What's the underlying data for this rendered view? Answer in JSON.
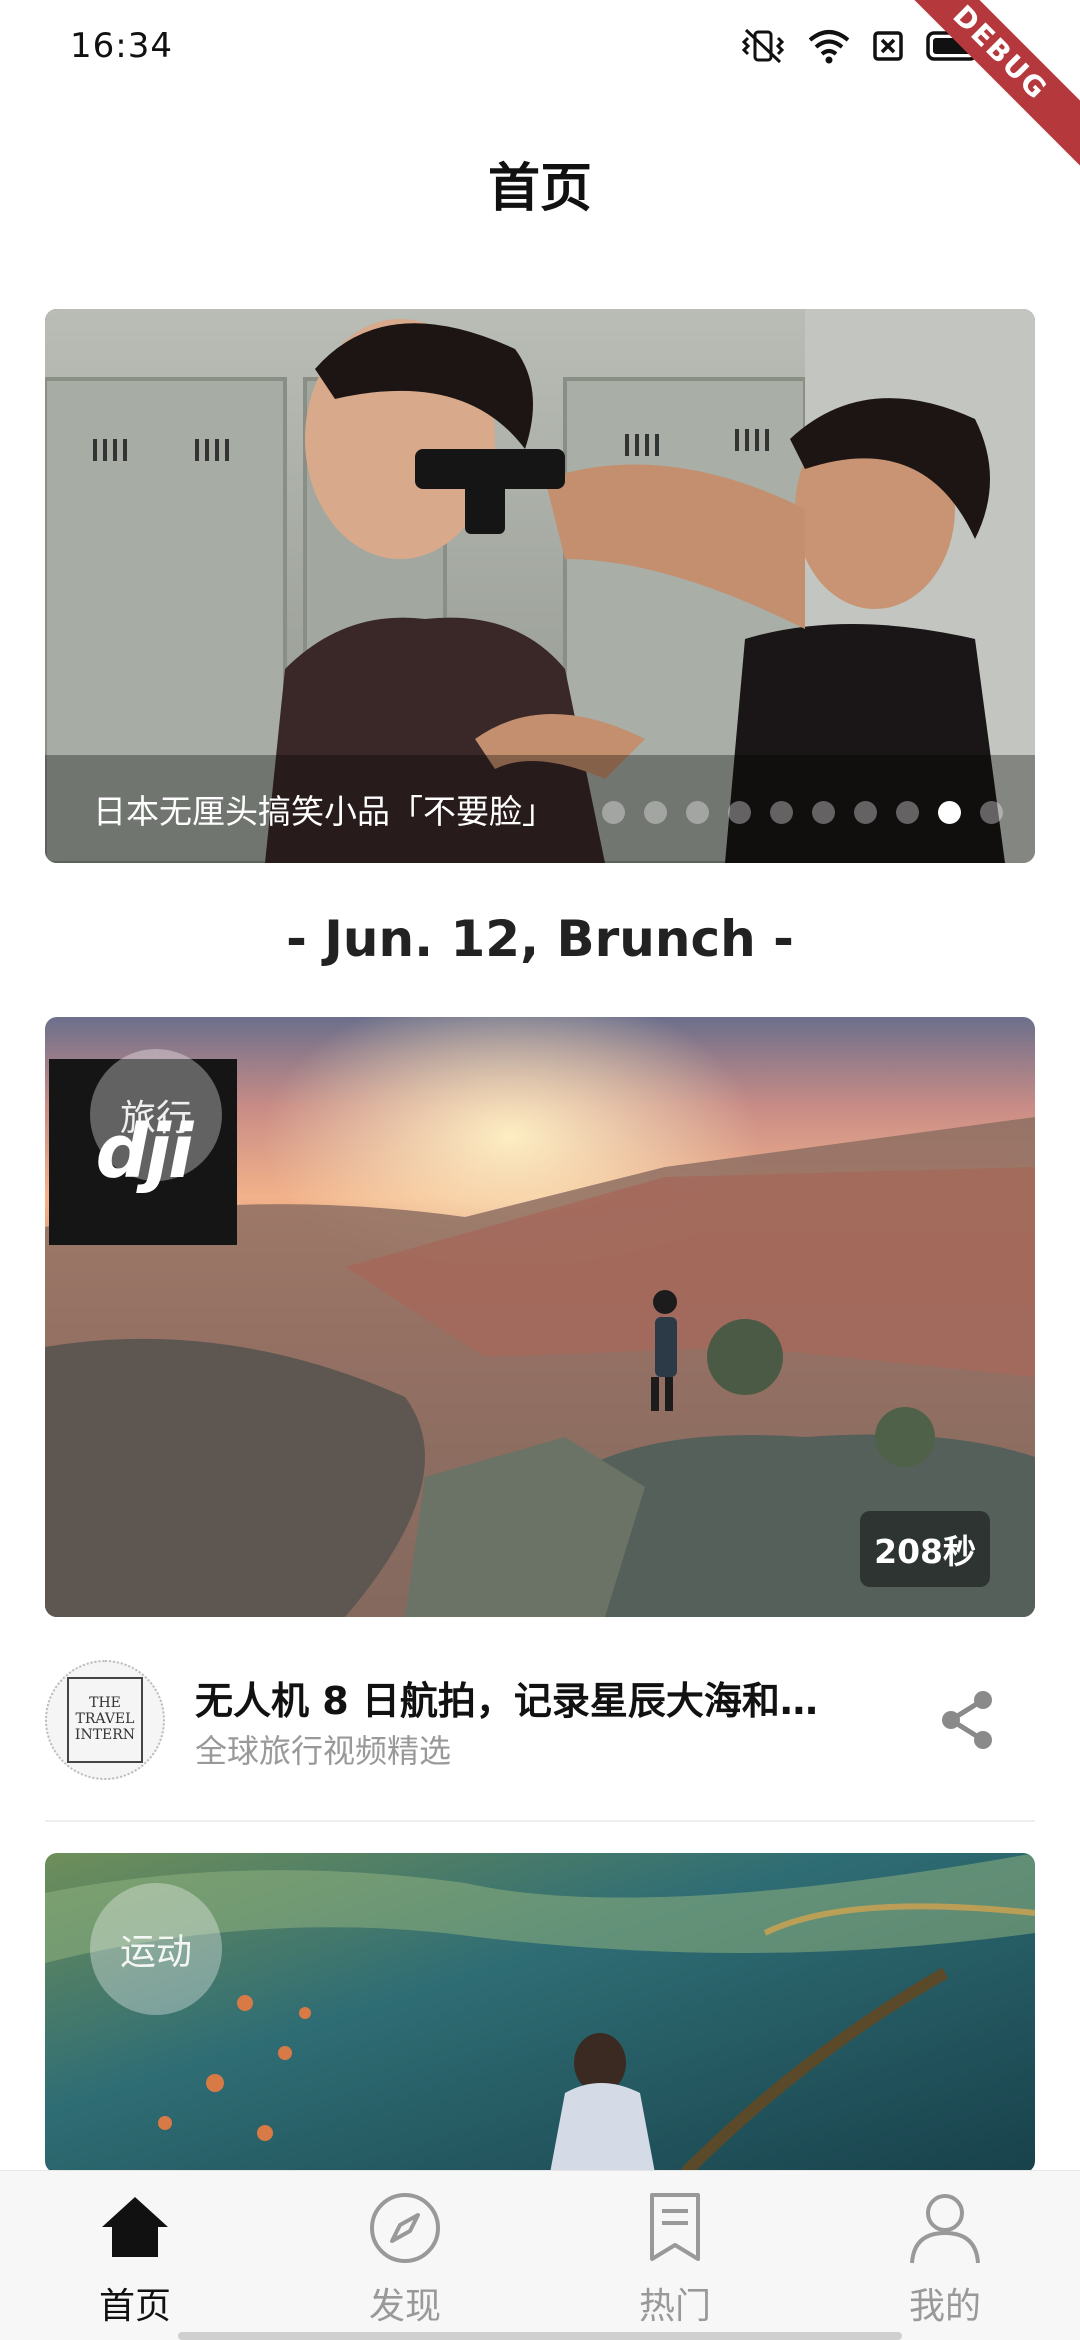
{
  "status_bar": {
    "time": "16:34",
    "debug_label": "DEBUG",
    "icons": [
      "vibrate-icon",
      "wifi-icon",
      "sim-off-icon",
      "battery-icon"
    ]
  },
  "header": {
    "title": "首页"
  },
  "banner": {
    "caption": "日本无厘头搞笑小品「不要脸」",
    "dot_count": 10,
    "active_dot": 8
  },
  "section": {
    "date_header": "- Jun. 12, Brunch -"
  },
  "feed": [
    {
      "category": "旅行",
      "brand_logo_text": "dji",
      "duration": "208秒",
      "title": "无人机 8 日航拍，记录星辰大海和…",
      "subtitle": "全球旅行视频精选",
      "author_logo_text": "THE TRAVEL INTERN"
    },
    {
      "category": "运动"
    }
  ],
  "bottom_nav": {
    "items": [
      {
        "label": "首页",
        "icon": "home-icon",
        "active": true
      },
      {
        "label": "发现",
        "icon": "compass-icon",
        "active": false
      },
      {
        "label": "热门",
        "icon": "bookmark-icon",
        "active": false
      },
      {
        "label": "我的",
        "icon": "user-icon",
        "active": false
      }
    ]
  },
  "colors": {
    "accent": "#111111",
    "inactive": "#999999",
    "debug_ribbon": "#b5383d"
  }
}
